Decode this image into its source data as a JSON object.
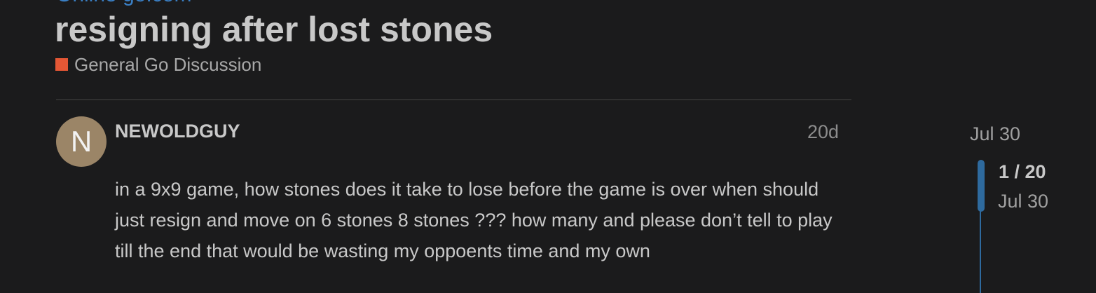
{
  "header": {
    "top_link": "Online go.com",
    "topic_title": "resigning after lost stones",
    "category": {
      "label": "General Go Discussion",
      "color": "#e45735"
    }
  },
  "post": {
    "avatar_letter": "N",
    "avatar_color": "#9b8567",
    "username": "NEWOLDGUY",
    "age": "20d",
    "body": "in a 9x9 game, how stones does it take to lose before the game is over when should just resign and move on 6 stones 8 stones ??? how many and please don’t tell to play till the end that would be wasting my oppoents time and my own"
  },
  "timeline": {
    "start_date": "Jul 30",
    "position": "1 / 20",
    "current_date": "Jul 30",
    "accent_color": "#2e6a9e"
  }
}
